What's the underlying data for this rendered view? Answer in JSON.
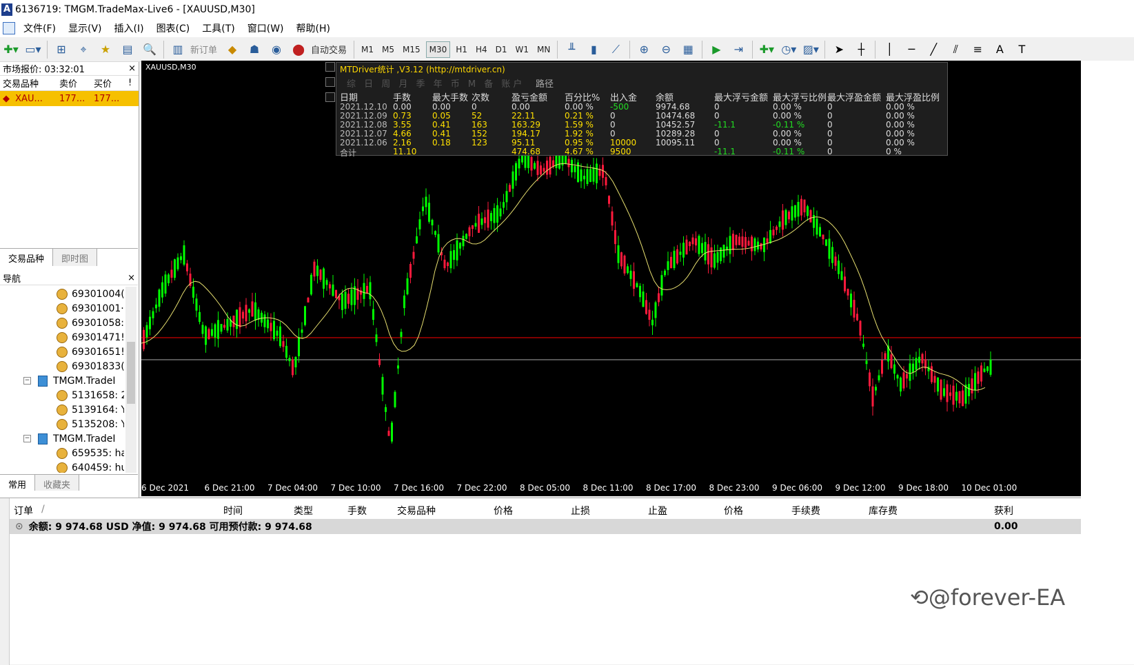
{
  "window": {
    "title": "6136719: TMGM.TradeMax-Live6 - [XAUUSD,M30]"
  },
  "menu": [
    "文件(F)",
    "显示(V)",
    "插入(I)",
    "图表(C)",
    "工具(T)",
    "窗口(W)",
    "帮助(H)"
  ],
  "toolbar": {
    "new_order": "新订单",
    "auto_trade": "自动交易",
    "timeframes": [
      "M1",
      "M5",
      "M15",
      "M30",
      "H1",
      "H4",
      "D1",
      "W1",
      "MN"
    ],
    "active_timeframe": "M30",
    "text_tool": "A"
  },
  "market_watch": {
    "title": "市场报价: 03:32:01",
    "close": "×",
    "columns": [
      "交易品种",
      "卖价",
      "买价",
      "!"
    ],
    "rows": [
      {
        "symbol": "XAU...",
        "bid": "177...",
        "ask": "177..."
      }
    ],
    "tabs": [
      "交易品种",
      "即时图"
    ]
  },
  "navigator": {
    "title": "导航",
    "close": "×",
    "items": [
      {
        "kind": "account",
        "label": "69301004("
      },
      {
        "kind": "account",
        "label": "69301001·"
      },
      {
        "kind": "account",
        "label": "69301058:"
      },
      {
        "kind": "account",
        "label": "69301471!"
      },
      {
        "kind": "account",
        "label": "69301651!"
      },
      {
        "kind": "account",
        "label": "69301833("
      },
      {
        "kind": "server",
        "label": "TMGM.TradeI"
      },
      {
        "kind": "account",
        "label": "5131658: 2"
      },
      {
        "kind": "account",
        "label": "5139164: Y"
      },
      {
        "kind": "account",
        "label": "5135208: Y"
      },
      {
        "kind": "server",
        "label": "TMGM.TradeI"
      },
      {
        "kind": "account",
        "label": "659535: ha"
      },
      {
        "kind": "account",
        "label": "640459: hu"
      }
    ],
    "tabs": [
      "常用",
      "收藏夹"
    ]
  },
  "chart": {
    "label": "XAUUSD,M30",
    "x_labels": [
      "6 Dec 2021",
      "6 Dec 21:00",
      "7 Dec 04:00",
      "7 Dec 10:00",
      "7 Dec 16:00",
      "7 Dec 22:00",
      "8 Dec 05:00",
      "8 Dec 11:00",
      "8 Dec 17:00",
      "8 Dec 23:00",
      "9 Dec 06:00",
      "9 Dec 12:00",
      "9 Dec 18:00",
      "10 Dec 01:00"
    ],
    "colors": {
      "bull": "#00ff00",
      "bear": "#ff1a3c",
      "ma": "#e8e070",
      "price_line": "#ff0000",
      "bg": "#000000"
    }
  },
  "stats_panel": {
    "title": "MTDriver统计 ,V3.12 (http://mtdriver.cn)",
    "menu": "综 日 周 月 季 年 币 M 备 账户",
    "path_label": "路径",
    "headers": [
      "日期",
      "手数",
      "最大手数",
      "次数",
      "盈亏金额",
      "百分比%",
      "出入金",
      "余额",
      "最大浮亏金额",
      "最大浮亏比例",
      "最大浮盈金额",
      "最大浮盈比例"
    ],
    "rows": [
      [
        "2021.12.10",
        "0.00",
        "0.00",
        "0",
        "0.00",
        "0.00 %",
        "-500",
        "9974.68",
        "0",
        "0.00 %",
        "0",
        "0.00 %"
      ],
      [
        "2021.12.09",
        "0.73",
        "0.05",
        "52",
        "22.11",
        "0.21 %",
        "0",
        "10474.68",
        "0",
        "0.00 %",
        "0",
        "0.00 %"
      ],
      [
        "2021.12.08",
        "3.55",
        "0.41",
        "163",
        "163.29",
        "1.59 %",
        "0",
        "10452.57",
        "-11.1",
        "-0.11 %",
        "0",
        "0.00 %"
      ],
      [
        "2021.12.07",
        "4.66",
        "0.41",
        "152",
        "194.17",
        "1.92 %",
        "0",
        "10289.28",
        "0",
        "0.00 %",
        "0",
        "0.00 %"
      ],
      [
        "2021.12.06",
        "2.16",
        "0.18",
        "123",
        "95.11",
        "0.95 %",
        "10000",
        "10095.11",
        "0",
        "0.00 %",
        "0",
        "0.00 %"
      ]
    ],
    "total": [
      "合计",
      "11.10",
      "",
      "",
      "474.68",
      "4.67 %",
      "9500",
      "",
      "-11.1",
      "-0.11 %",
      "0",
      "0 %"
    ]
  },
  "orders": {
    "columns": [
      "订单",
      "/",
      "时间",
      "类型",
      "手数",
      "交易品种",
      "价格",
      "止损",
      "止盈",
      "价格",
      "手续费",
      "库存费",
      "获利"
    ],
    "balance_text": "余额: 9 974.68 USD  净值: 9 974.68  可用预付款: 9 974.68",
    "profit": "0.00"
  },
  "watermark": "@forever-EA"
}
